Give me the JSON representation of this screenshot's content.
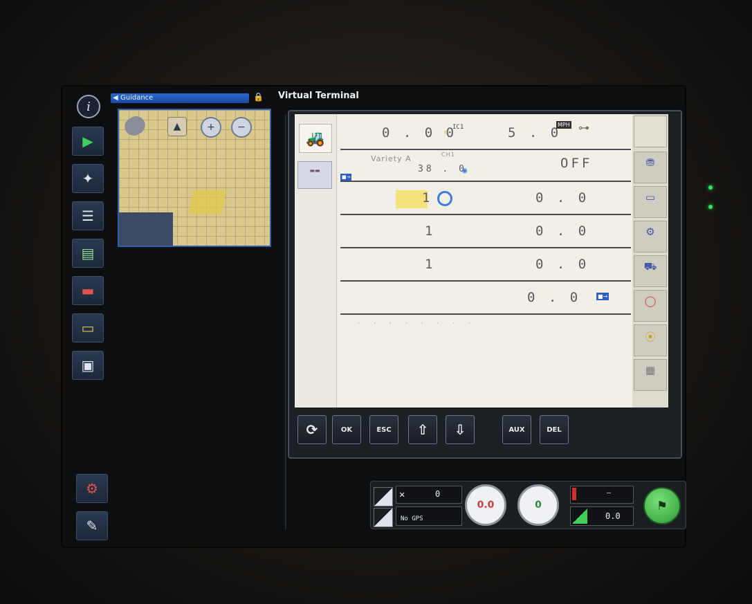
{
  "colors": {
    "accent_blue": "#2b6bd0",
    "vt_background": "#f1efe6",
    "highlight_yellow": "#f5e27a",
    "status_green": "#38e060"
  },
  "sidebar": {
    "items": [
      {
        "name": "info-icon",
        "glyph": "i"
      },
      {
        "name": "guidance-arrow-icon",
        "glyph": "▶"
      },
      {
        "name": "gps-satellite-icon",
        "glyph": "✦"
      },
      {
        "name": "task-list-icon",
        "glyph": "☰"
      },
      {
        "name": "document-icon",
        "glyph": "▤"
      },
      {
        "name": "boom-sections-icon",
        "glyph": "▬"
      },
      {
        "name": "implement-icon",
        "glyph": "▭"
      },
      {
        "name": "virtual-terminal-icon",
        "glyph": "▣"
      },
      {
        "name": "tractor-settings-icon",
        "glyph": "⚙"
      },
      {
        "name": "wrench-icon",
        "glyph": "🔧"
      }
    ]
  },
  "guidance": {
    "header": "Guidance",
    "lock_icon": "lock-icon"
  },
  "virtual_terminal": {
    "title": "Virtual Terminal",
    "left_softkey": "",
    "rows": [
      {
        "left_value": "0 . 0 0",
        "left_tag": "IC1",
        "right_value": "5 . 0",
        "right_unit": "MPH"
      },
      {
        "variety_label": "Variety A",
        "tag": "CH1",
        "value": "38 . 0",
        "right_value": "OFF"
      },
      {
        "left_value": "1",
        "right_value": "0 . 0"
      },
      {
        "left_value": "1",
        "right_value": "0 . 0"
      },
      {
        "left_value": "1",
        "right_value": "0 . 0"
      },
      {
        "right_value": "0 . 0"
      }
    ]
  },
  "softkeys": {
    "ok": "OK",
    "esc": "ESC",
    "aux": "AUX",
    "del": "DEL"
  },
  "status_bar": {
    "satellite_count": "0",
    "gps_status": "No GPS",
    "gauge_left": "0.0",
    "gauge_right": "0",
    "speed_value": "0.0",
    "speed_dash": "—"
  }
}
